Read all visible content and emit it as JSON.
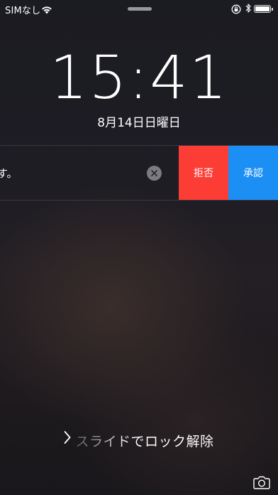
{
  "status_bar": {
    "carrier": "SIMなし",
    "wifi_icon": "wifi-icon",
    "rotation_lock_icon": "rotation-lock-icon",
    "bluetooth_icon": "bluetooth-icon",
    "battery_level": 1.0
  },
  "lock_screen": {
    "time": "15:41",
    "date": "8月14日日曜日"
  },
  "notification": {
    "text": "す。",
    "clear_icon": "clear-x-icon",
    "actions": [
      {
        "label": "拒否",
        "color": "#fb3d36"
      },
      {
        "label": "承認",
        "color": "#1c8ff5"
      }
    ]
  },
  "slide_to_unlock": {
    "label": "スライドでロック解除",
    "icon": "chevron-right-icon"
  },
  "camera": {
    "icon": "camera-icon"
  }
}
